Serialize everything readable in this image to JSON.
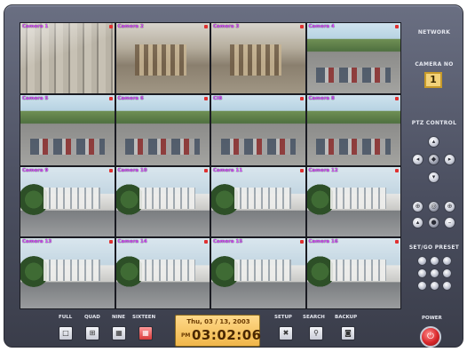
{
  "colors": {
    "frame": "#4b4f60",
    "camera_label": "#d84cff",
    "clock_bg": "#f0b64a",
    "power": "#d8262a",
    "active_view": "#d83a3a"
  },
  "cameras": [
    {
      "label": "Camera 1",
      "scene": "office"
    },
    {
      "label": "Camera 2",
      "scene": "warehouse"
    },
    {
      "label": "Camera 3",
      "scene": "warehouse"
    },
    {
      "label": "Camera 4",
      "scene": "lot"
    },
    {
      "label": "Camera 5",
      "scene": "lot"
    },
    {
      "label": "Camera 6",
      "scene": "lot"
    },
    {
      "label": "CIB",
      "scene": "lot"
    },
    {
      "label": "Camera 8",
      "scene": "lot"
    },
    {
      "label": "Camera 9",
      "scene": "bldg"
    },
    {
      "label": "Camera 10",
      "scene": "bldg"
    },
    {
      "label": "Camera 11",
      "scene": "bldg"
    },
    {
      "label": "Camera 12",
      "scene": "bldg"
    },
    {
      "label": "Camera 13",
      "scene": "bldg"
    },
    {
      "label": "Camera 14",
      "scene": "bldg"
    },
    {
      "label": "Camera 15",
      "scene": "bldg"
    },
    {
      "label": "Camera 16",
      "scene": "bldg"
    }
  ],
  "right_panel": {
    "network_label": "NETWORK",
    "camera_no_label": "CAMERA NO",
    "camera_no": "1",
    "ptz_label": "PTZ CONTROL",
    "preset_label": "SET/GO PRESET"
  },
  "view_buttons": [
    {
      "label": "FULL",
      "icon": "full-view-icon"
    },
    {
      "label": "QUAD",
      "icon": "quad-view-icon"
    },
    {
      "label": "NINE",
      "icon": "nine-view-icon"
    },
    {
      "label": "SIXTEEN",
      "icon": "sixteen-view-icon",
      "active": true
    }
  ],
  "clock": {
    "date": "Thu, 03 / 13, 2003",
    "ampm": "PM",
    "time": "03:02:06"
  },
  "tool_buttons": [
    {
      "label": "SETUP",
      "icon": "setup-icon"
    },
    {
      "label": "SEARCH",
      "icon": "search-icon"
    },
    {
      "label": "BACKUP",
      "icon": "backup-icon"
    }
  ],
  "power_label": "POWER"
}
